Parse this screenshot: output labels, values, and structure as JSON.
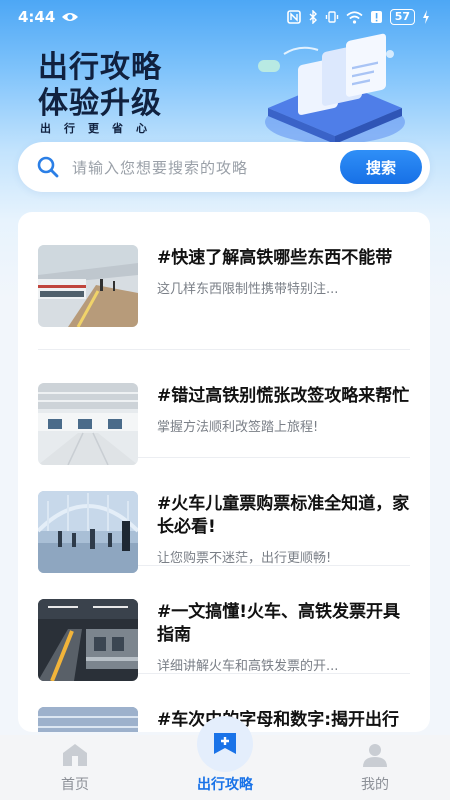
{
  "status_bar": {
    "time": "4:44",
    "battery": "57"
  },
  "hero": {
    "title_line1": "出行攻略",
    "title_line2": "体验升级",
    "subtitle": "出行更省心"
  },
  "search": {
    "placeholder": "请输入您想要搜索的攻略",
    "button_label": "搜索"
  },
  "articles": [
    {
      "title": "#快速了解高铁哪些东西不能带",
      "desc": "这几样东西限制性携带特别注...",
      "thumb": "high-speed-train-platform"
    },
    {
      "title": "#错过高铁别慌张改签攻略来帮忙",
      "desc": "掌握方法顺利改签踏上旅程!",
      "thumb": "station-hall"
    },
    {
      "title": "#火车儿童票购票标准全知道，家长必看!",
      "desc": "让您购票不迷茫，出行更顺畅!",
      "thumb": "station-concourse-crowd"
    },
    {
      "title": "#一文搞懂!火车、高铁发票开具指南",
      "desc": "详细讲解火车和高铁发票的开...",
      "thumb": "metro-platform-train"
    },
    {
      "title": "#车次中的字母和数字:揭开出行密码",
      "desc": "",
      "thumb": "station-ceiling"
    }
  ],
  "bottom_nav": {
    "items": [
      {
        "label": "首页",
        "icon": "home-icon",
        "active": false
      },
      {
        "label": "出行攻略",
        "icon": "guide-flag-icon",
        "active": true
      },
      {
        "label": "我的",
        "icon": "user-icon",
        "active": false
      }
    ]
  },
  "colors": {
    "accent": "#1a73e8",
    "header_gradient_top": "#4da7f5",
    "title_text": "#10213f"
  }
}
